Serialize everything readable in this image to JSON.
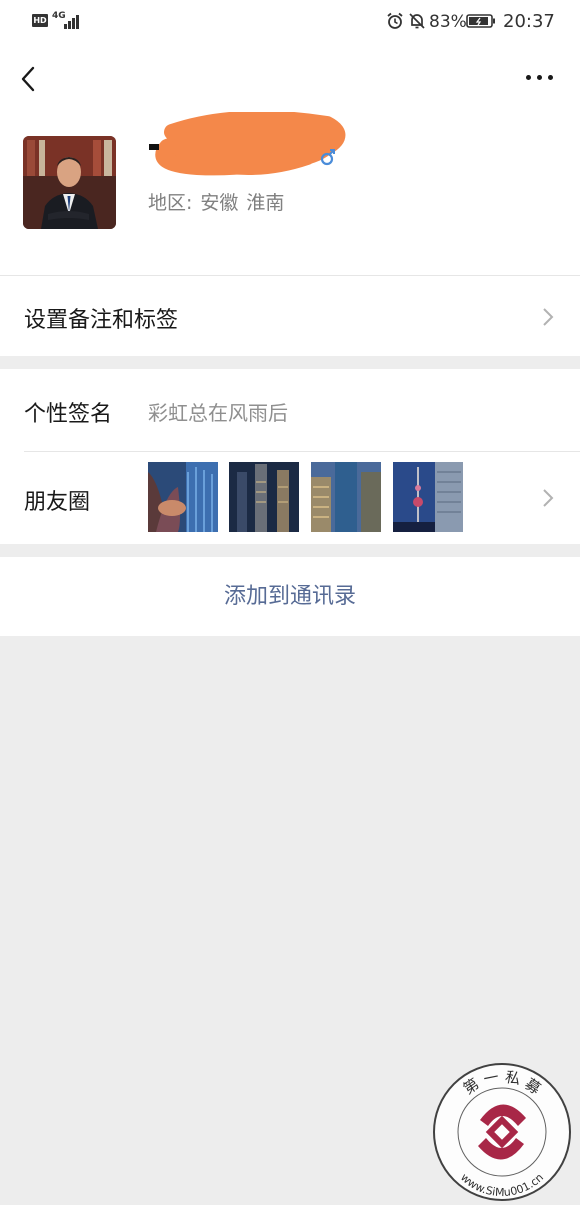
{
  "status_bar": {
    "hd_label": "HD",
    "network_label": "4G",
    "battery_percent": "83%",
    "time": "20:37",
    "icons": [
      "signal-icon",
      "alarm-icon",
      "mute-bell-icon",
      "battery-icon"
    ]
  },
  "nav": {
    "back_icon": "chevron-left-icon",
    "more_icon": "more-dots-icon"
  },
  "profile": {
    "region_label": "地区:",
    "region_province": "安徽",
    "region_city": "淮南"
  },
  "rows": {
    "remark_label": "设置备注和标签",
    "signature_label": "个性签名",
    "signature_value": "彩虹总在风雨后",
    "moments_label": "朋友圈"
  },
  "actions": {
    "add_contact": "添加到通讯录"
  },
  "watermark": {
    "text_top": "第 一 私 募",
    "text_bottom": "www.SiMu001.cn"
  },
  "colors": {
    "link_blue": "#576b95",
    "background": "#ededed",
    "redaction_orange": "#f4884a"
  }
}
